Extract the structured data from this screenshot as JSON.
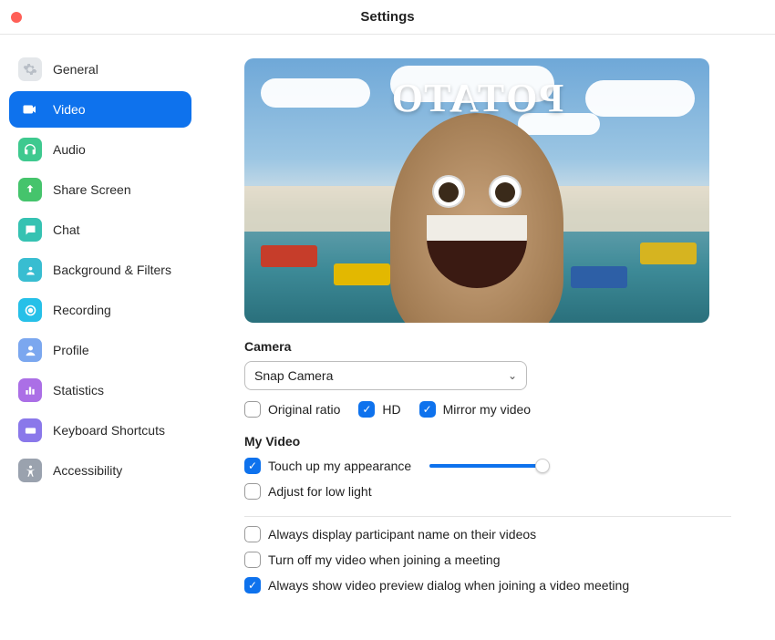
{
  "window": {
    "title": "Settings"
  },
  "sidebar": {
    "items": [
      {
        "label": "General"
      },
      {
        "label": "Video"
      },
      {
        "label": "Audio"
      },
      {
        "label": "Share Screen"
      },
      {
        "label": "Chat"
      },
      {
        "label": "Background & Filters"
      },
      {
        "label": "Recording"
      },
      {
        "label": "Profile"
      },
      {
        "label": "Statistics"
      },
      {
        "label": "Keyboard Shortcuts"
      },
      {
        "label": "Accessibility"
      }
    ],
    "active_index": 1
  },
  "preview": {
    "overlay_text": "POTATO"
  },
  "camera": {
    "section_label": "Camera",
    "selected": "Snap Camera",
    "options": {
      "original_ratio": {
        "label": "Original ratio",
        "checked": false
      },
      "hd": {
        "label": "HD",
        "checked": true
      },
      "mirror": {
        "label": "Mirror my video",
        "checked": true
      }
    }
  },
  "my_video": {
    "section_label": "My Video",
    "touch_up": {
      "label": "Touch up my appearance",
      "checked": true,
      "slider_pct": 96
    },
    "low_light": {
      "label": "Adjust for low light",
      "checked": false
    }
  },
  "more": {
    "display_name": {
      "label": "Always display participant name on their videos",
      "checked": false
    },
    "turn_off_join": {
      "label": "Turn off my video when joining a meeting",
      "checked": false
    },
    "preview_dialog": {
      "label": "Always show video preview dialog when joining a video meeting",
      "checked": true
    }
  }
}
